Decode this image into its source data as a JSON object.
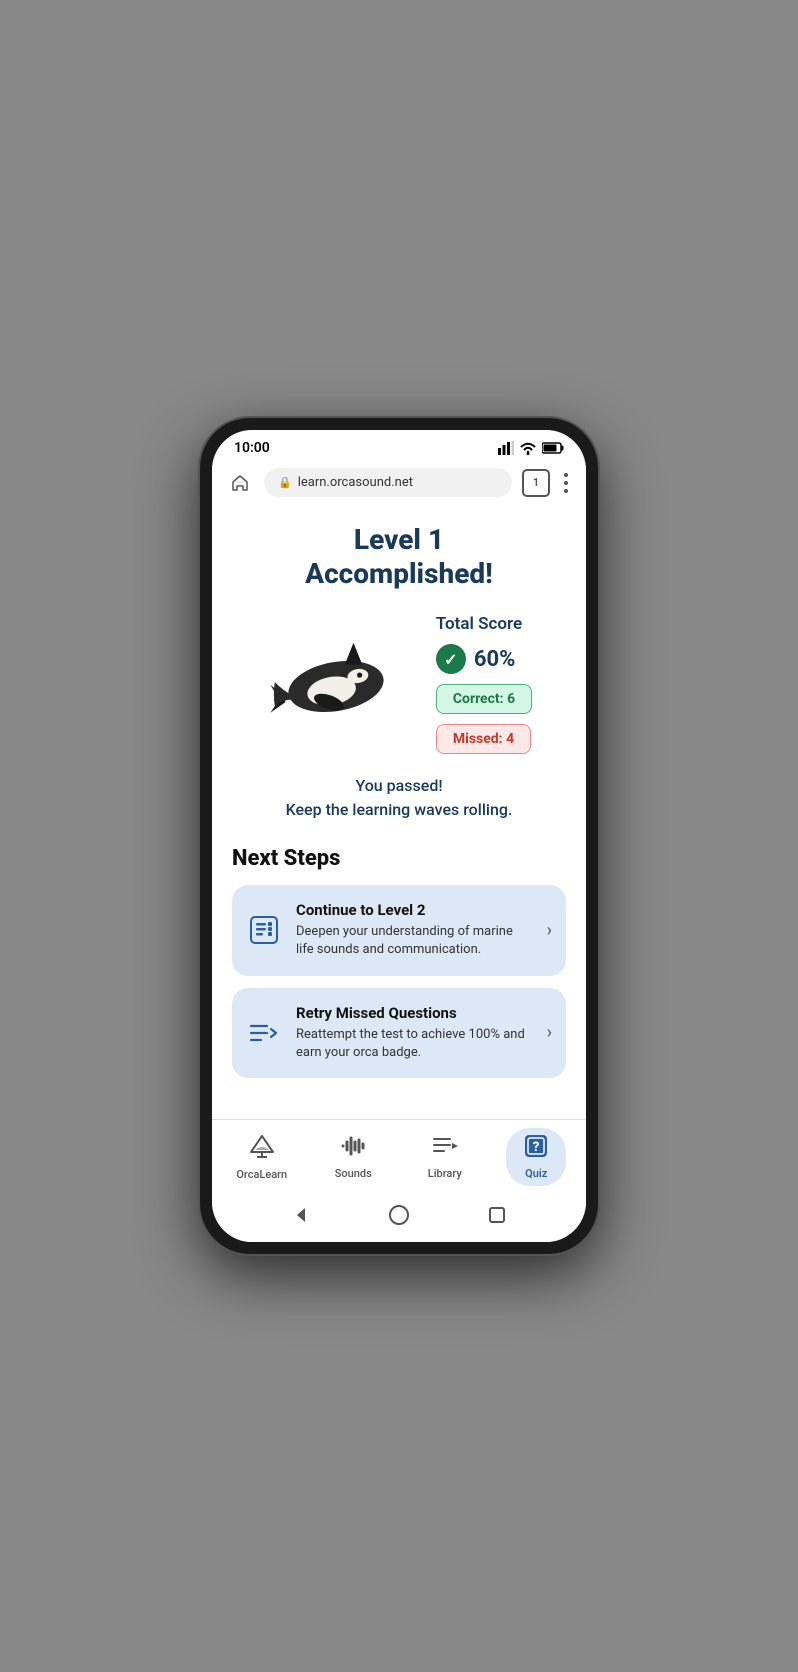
{
  "statusBar": {
    "time": "10:00",
    "tabCount": "1"
  },
  "browserBar": {
    "url": "learn.orcasound.net"
  },
  "page": {
    "titleLine1": "Level 1",
    "titleLine2": "Accomplished!",
    "scoreLabel": "Total Score",
    "scorePercent": "60%",
    "correctBadge": "Correct: 6",
    "missedBadge": "Missed: 4",
    "passMessage1": "You passed!",
    "passMessage2": "Keep the learning waves rolling.",
    "nextStepsTitle": "Next Steps"
  },
  "steps": [
    {
      "title": "Continue to Level 2",
      "description": "Deepen your understanding of marine life sounds and communication."
    },
    {
      "title": "Retry Missed Questions",
      "description": "Reattempt the test to achieve 100% and earn your orca badge."
    }
  ],
  "nav": {
    "items": [
      {
        "label": "OrcaLearn",
        "icon": "⛵"
      },
      {
        "label": "Sounds",
        "icon": "🎙"
      },
      {
        "label": "Library",
        "icon": "🎵"
      },
      {
        "label": "Quiz",
        "icon": "📋",
        "active": true
      }
    ]
  }
}
